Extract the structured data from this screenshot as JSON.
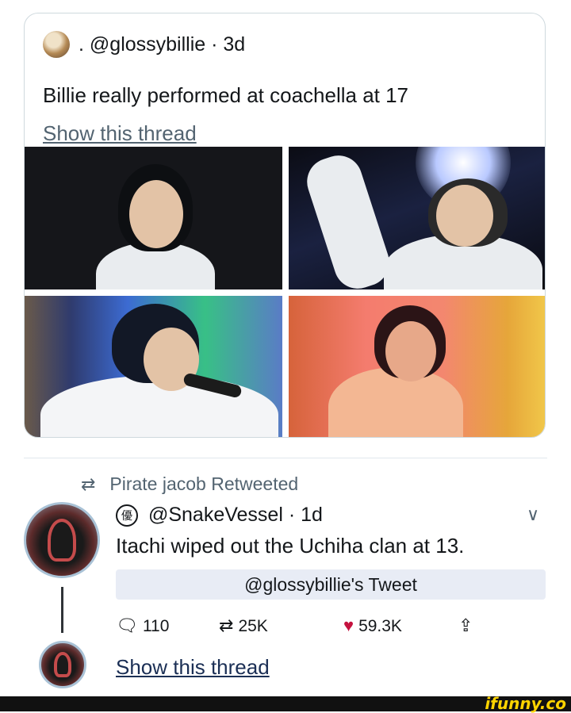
{
  "quoted_tweet": {
    "separator": ".",
    "handle": "@glossybillie",
    "time": "· 3d",
    "text": "Billie really performed at coachella at 17",
    "show_thread": "Show this thread",
    "avatar_icon": "profile-photo-icon"
  },
  "retweet": {
    "icon": "retweet-icon",
    "label": "Pirate jacob Retweeted"
  },
  "tweet": {
    "name_glyph": "優",
    "handle": "@SnakeVessel",
    "time": "· 1d",
    "text": "Itachi wiped out the Uchiha clan at 13.",
    "reference": "@glossybillie's Tweet",
    "menu_icon": "chevron-down-icon",
    "actions": {
      "replies": "110",
      "retweets": "25K",
      "likes": "59.3K"
    },
    "show_thread": "Show this thread"
  },
  "colors": {
    "like": "#c5123f",
    "watermark": "#ffd400",
    "border": "#cfd9de"
  },
  "watermark": "ifunny.co"
}
